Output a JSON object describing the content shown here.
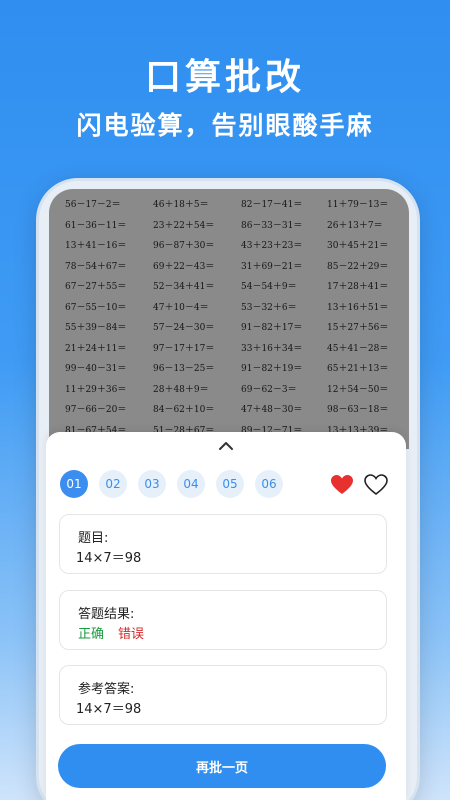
{
  "hero": {
    "title": "口算批改",
    "subtitle": "闪电验算，告别眼酸手麻"
  },
  "worksheet": {
    "rows": [
      [
        "56－17－2＝",
        "46＋18＋5＝",
        "82－17－41＝",
        "11＋79－13＝"
      ],
      [
        "61－36－11＝",
        "23＋22＋54＝",
        "86－33－31＝",
        "26＋13＋7＝"
      ],
      [
        "13＋41－16＝",
        "96－87＋30＝",
        "43＋23＋23＝",
        "30＋45＋21＝"
      ],
      [
        "78－54＋67＝",
        "69＋22－43＝",
        "31＋69－21＝",
        "85－22＋29＝"
      ],
      [
        "67－27＋55＝",
        "52－34＋41＝",
        "54－54＋9＝",
        "17＋28＋41＝"
      ],
      [
        "67－55－10＝",
        "47＋10－4＝",
        "53－32＋6＝",
        "13＋16＋51＝"
      ],
      [
        "55＋39－84＝",
        "57－24－30＝",
        "91－82＋17＝",
        "15＋27＋56＝"
      ],
      [
        "21＋24＋11＝",
        "97－17＋17＝",
        "33＋16＋34＝",
        "45＋41－28＝"
      ],
      [
        "99－40－31＝",
        "96－13－25＝",
        "91－82＋19＝",
        "65＋21＋13＝"
      ],
      [
        "11＋29＋36＝",
        "28＋48＋9＝",
        "69－62－3＝",
        "12＋54－50＝"
      ],
      [
        "97－66－20＝",
        "84－62＋10＝",
        "47＋48－30＝",
        "98－63－18＝"
      ],
      [
        "81－67＋54＝",
        "51－28＋67＝",
        "89－12－71＝",
        "13＋13＋39＝"
      ]
    ]
  },
  "panel": {
    "tabs": [
      "01",
      "02",
      "03",
      "04",
      "05",
      "06"
    ],
    "active_tab": 0,
    "question": {
      "label": "题目:",
      "value": "14×7＝98"
    },
    "result": {
      "label": "答题结果:",
      "correct": "正确",
      "wrong": "错误"
    },
    "reference": {
      "label": "参考答案:",
      "value": "14×7＝98"
    },
    "action_button": "再批一页"
  },
  "colors": {
    "accent": "#2f8ef0",
    "correct": "#1a9b3c",
    "wrong": "#d42a2a",
    "heart": "#e8312f"
  }
}
